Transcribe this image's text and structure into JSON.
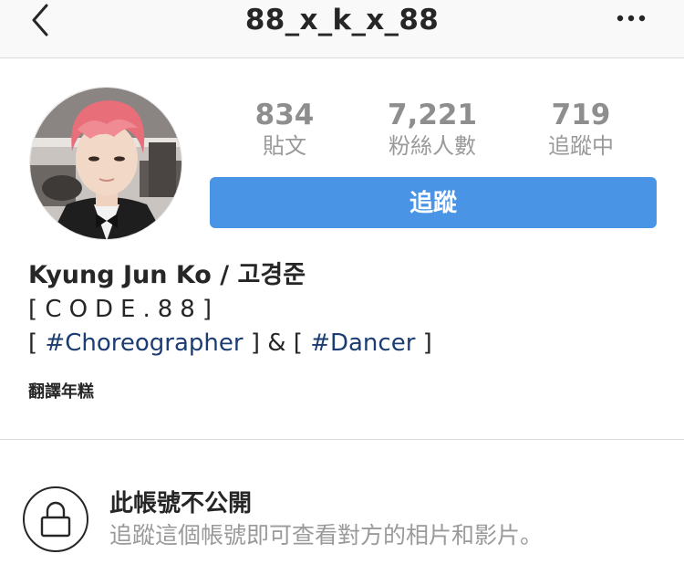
{
  "header": {
    "title": "88_x_k_x_88",
    "back_icon": "chevron-left-icon",
    "more_icon": "more-horizontal-icon"
  },
  "profile": {
    "avatar_icon": "profile-photo",
    "stats": [
      {
        "value": "834",
        "label": "貼文"
      },
      {
        "value": "7,221",
        "label": "粉絲人數"
      },
      {
        "value": "719",
        "label": "追蹤中"
      }
    ],
    "follow_label": "追蹤",
    "follow_color": "#4a94e6"
  },
  "bio": {
    "name": "Kyung Jun Ko / 고경준",
    "line1_open": "[",
    "line1_text": "CODE.88",
    "line1_close": "]",
    "line2_prefix": "[ ",
    "hashtag1": "#Choreographer",
    "line2_middle": " ] & [ ",
    "hashtag2": "#Dancer",
    "line2_suffix": " ]",
    "translate_label": "翻譯年糕",
    "hashtag_color": "#1b3d73"
  },
  "private": {
    "icon": "lock-icon",
    "title": "此帳號不公開",
    "description": "追蹤這個帳號即可查看對方的相片和影片。"
  }
}
